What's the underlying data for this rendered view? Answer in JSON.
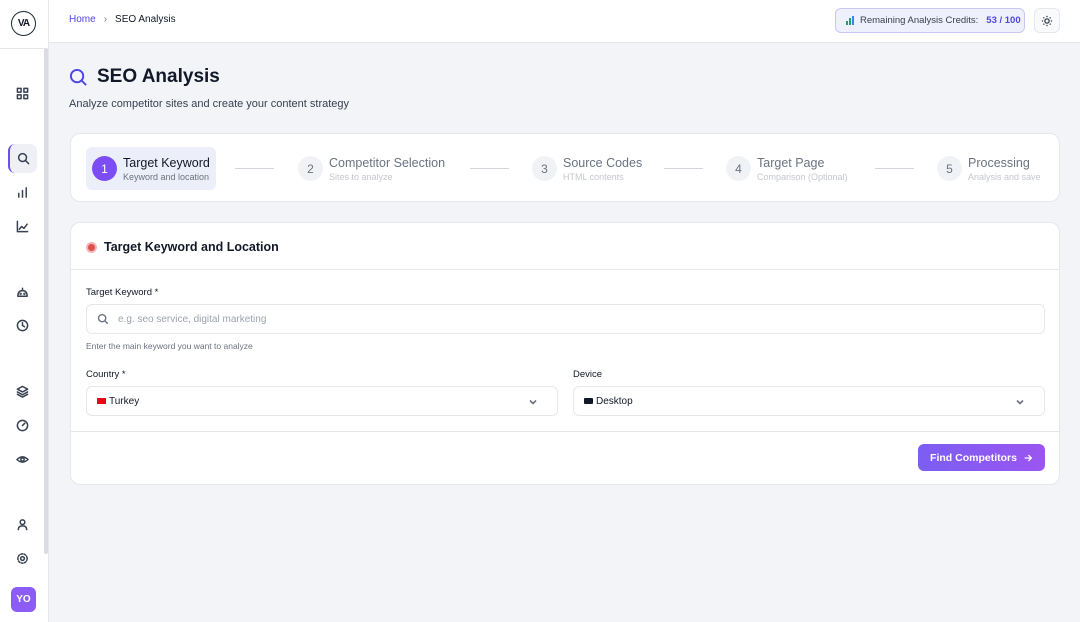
{
  "app": {
    "logo_text": "VA"
  },
  "breadcrumb": {
    "home": "Home",
    "separator": "›",
    "current": "SEO Analysis"
  },
  "credits": {
    "label": "Remaining Analysis Credits:",
    "value": "53 / 100",
    "icon": "bar-chart-icon"
  },
  "header": {
    "title": "SEO Analysis",
    "subtitle": "Analyze competitor sites and create your content strategy",
    "icon": "search-icon"
  },
  "steps": [
    {
      "num": "1",
      "label": "Target Keyword",
      "sub": "Keyword and location",
      "active": true
    },
    {
      "num": "2",
      "label": "Competitor Selection",
      "sub": "Sites to analyze",
      "active": false
    },
    {
      "num": "3",
      "label": "Source Codes",
      "sub": "HTML contents",
      "active": false
    },
    {
      "num": "4",
      "label": "Target Page",
      "sub": "Comparison (Optional)",
      "active": false
    },
    {
      "num": "5",
      "label": "Processing",
      "sub": "Analysis and save",
      "active": false
    }
  ],
  "form": {
    "section_title": "Target Keyword and Location",
    "keyword": {
      "label": "Target Keyword *",
      "placeholder": "e.g. seo service, digital marketing",
      "value": "",
      "hint": "Enter the main keyword you want to analyze"
    },
    "country": {
      "label": "Country *",
      "value": "Turkey"
    },
    "device": {
      "label": "Device",
      "value": "Desktop"
    },
    "submit": "Find Competitors"
  },
  "user": {
    "initials": "YO"
  },
  "colors": {
    "accent": "#7c4df4",
    "link": "#4f46e5"
  }
}
